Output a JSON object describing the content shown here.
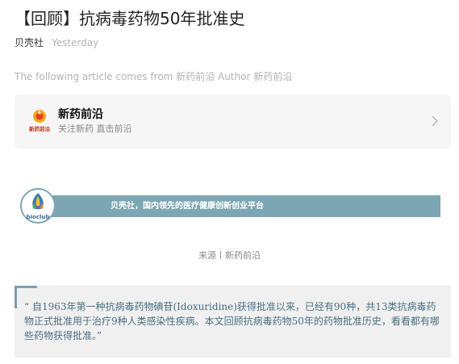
{
  "article": {
    "title": "【回顾】抗病毒药物50年批准史",
    "account_name": "贝壳社",
    "date": "Yesterday",
    "source_line": "The following article comes from 新药前沿 Author 新药前沿"
  },
  "profile_card": {
    "name": "新药前沿",
    "description": "关注新药 直击前沿",
    "logo_icon": "xinyao-qianyan-logo-icon",
    "logo_text": "新药前沿",
    "chevron_icon": "chevron-right-icon"
  },
  "banner": {
    "text": "贝壳社，国内领先的医疗健康创新创业平台",
    "logo_icon": "bioclub-logo-icon",
    "logo_text": "bioclub",
    "bar_color": "#7ca6b3"
  },
  "source_credit": "来源丨新药前沿",
  "quote": {
    "text": "“ 自1963年第一种抗病毒药物碘苷(Idoxuridine)获得批准以来，已经有90种，共13类抗病毒药物正式批准用于治疗9种人类感染性疾病。本文回顾抗病毒药物50年的药物批准历史，看看都有哪些药物获得批准。”",
    "accent_color": "#7c9fae"
  }
}
